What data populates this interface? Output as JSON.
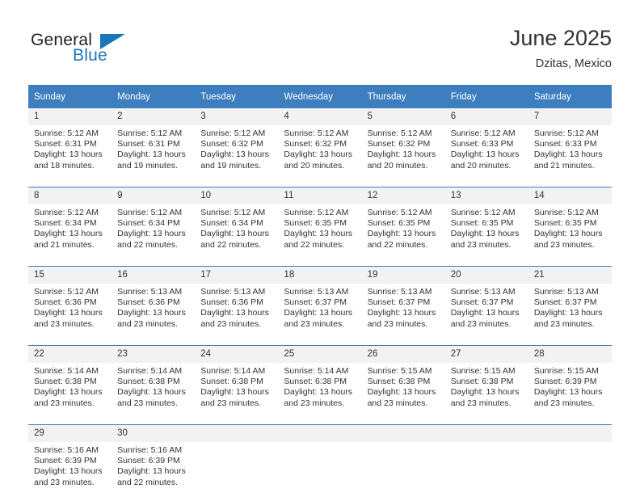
{
  "brand": {
    "name_part1": "General",
    "name_part2": "Blue",
    "triangle_icon": "triangle-icon",
    "accent_color": "#1b76bc"
  },
  "header": {
    "title": "June 2025",
    "subtitle": "Dzitas, Mexico"
  },
  "theme": {
    "header_blue": "#3d7ebf",
    "daynum_bg": "#f2f2f2",
    "text": "#333333"
  },
  "calendar": {
    "weekday_headers": [
      "Sunday",
      "Monday",
      "Tuesday",
      "Wednesday",
      "Thursday",
      "Friday",
      "Saturday"
    ],
    "weeks": [
      [
        {
          "day": "1",
          "sunrise": "Sunrise: 5:12 AM",
          "sunset": "Sunset: 6:31 PM",
          "daylight1": "Daylight: 13 hours",
          "daylight2": "and 18 minutes."
        },
        {
          "day": "2",
          "sunrise": "Sunrise: 5:12 AM",
          "sunset": "Sunset: 6:31 PM",
          "daylight1": "Daylight: 13 hours",
          "daylight2": "and 19 minutes."
        },
        {
          "day": "3",
          "sunrise": "Sunrise: 5:12 AM",
          "sunset": "Sunset: 6:32 PM",
          "daylight1": "Daylight: 13 hours",
          "daylight2": "and 19 minutes."
        },
        {
          "day": "4",
          "sunrise": "Sunrise: 5:12 AM",
          "sunset": "Sunset: 6:32 PM",
          "daylight1": "Daylight: 13 hours",
          "daylight2": "and 20 minutes."
        },
        {
          "day": "5",
          "sunrise": "Sunrise: 5:12 AM",
          "sunset": "Sunset: 6:32 PM",
          "daylight1": "Daylight: 13 hours",
          "daylight2": "and 20 minutes."
        },
        {
          "day": "6",
          "sunrise": "Sunrise: 5:12 AM",
          "sunset": "Sunset: 6:33 PM",
          "daylight1": "Daylight: 13 hours",
          "daylight2": "and 20 minutes."
        },
        {
          "day": "7",
          "sunrise": "Sunrise: 5:12 AM",
          "sunset": "Sunset: 6:33 PM",
          "daylight1": "Daylight: 13 hours",
          "daylight2": "and 21 minutes."
        }
      ],
      [
        {
          "day": "8",
          "sunrise": "Sunrise: 5:12 AM",
          "sunset": "Sunset: 6:34 PM",
          "daylight1": "Daylight: 13 hours",
          "daylight2": "and 21 minutes."
        },
        {
          "day": "9",
          "sunrise": "Sunrise: 5:12 AM",
          "sunset": "Sunset: 6:34 PM",
          "daylight1": "Daylight: 13 hours",
          "daylight2": "and 22 minutes."
        },
        {
          "day": "10",
          "sunrise": "Sunrise: 5:12 AM",
          "sunset": "Sunset: 6:34 PM",
          "daylight1": "Daylight: 13 hours",
          "daylight2": "and 22 minutes."
        },
        {
          "day": "11",
          "sunrise": "Sunrise: 5:12 AM",
          "sunset": "Sunset: 6:35 PM",
          "daylight1": "Daylight: 13 hours",
          "daylight2": "and 22 minutes."
        },
        {
          "day": "12",
          "sunrise": "Sunrise: 5:12 AM",
          "sunset": "Sunset: 6:35 PM",
          "daylight1": "Daylight: 13 hours",
          "daylight2": "and 22 minutes."
        },
        {
          "day": "13",
          "sunrise": "Sunrise: 5:12 AM",
          "sunset": "Sunset: 6:35 PM",
          "daylight1": "Daylight: 13 hours",
          "daylight2": "and 23 minutes."
        },
        {
          "day": "14",
          "sunrise": "Sunrise: 5:12 AM",
          "sunset": "Sunset: 6:35 PM",
          "daylight1": "Daylight: 13 hours",
          "daylight2": "and 23 minutes."
        }
      ],
      [
        {
          "day": "15",
          "sunrise": "Sunrise: 5:12 AM",
          "sunset": "Sunset: 6:36 PM",
          "daylight1": "Daylight: 13 hours",
          "daylight2": "and 23 minutes."
        },
        {
          "day": "16",
          "sunrise": "Sunrise: 5:13 AM",
          "sunset": "Sunset: 6:36 PM",
          "daylight1": "Daylight: 13 hours",
          "daylight2": "and 23 minutes."
        },
        {
          "day": "17",
          "sunrise": "Sunrise: 5:13 AM",
          "sunset": "Sunset: 6:36 PM",
          "daylight1": "Daylight: 13 hours",
          "daylight2": "and 23 minutes."
        },
        {
          "day": "18",
          "sunrise": "Sunrise: 5:13 AM",
          "sunset": "Sunset: 6:37 PM",
          "daylight1": "Daylight: 13 hours",
          "daylight2": "and 23 minutes."
        },
        {
          "day": "19",
          "sunrise": "Sunrise: 5:13 AM",
          "sunset": "Sunset: 6:37 PM",
          "daylight1": "Daylight: 13 hours",
          "daylight2": "and 23 minutes."
        },
        {
          "day": "20",
          "sunrise": "Sunrise: 5:13 AM",
          "sunset": "Sunset: 6:37 PM",
          "daylight1": "Daylight: 13 hours",
          "daylight2": "and 23 minutes."
        },
        {
          "day": "21",
          "sunrise": "Sunrise: 5:13 AM",
          "sunset": "Sunset: 6:37 PM",
          "daylight1": "Daylight: 13 hours",
          "daylight2": "and 23 minutes."
        }
      ],
      [
        {
          "day": "22",
          "sunrise": "Sunrise: 5:14 AM",
          "sunset": "Sunset: 6:38 PM",
          "daylight1": "Daylight: 13 hours",
          "daylight2": "and 23 minutes."
        },
        {
          "day": "23",
          "sunrise": "Sunrise: 5:14 AM",
          "sunset": "Sunset: 6:38 PM",
          "daylight1": "Daylight: 13 hours",
          "daylight2": "and 23 minutes."
        },
        {
          "day": "24",
          "sunrise": "Sunrise: 5:14 AM",
          "sunset": "Sunset: 6:38 PM",
          "daylight1": "Daylight: 13 hours",
          "daylight2": "and 23 minutes."
        },
        {
          "day": "25",
          "sunrise": "Sunrise: 5:14 AM",
          "sunset": "Sunset: 6:38 PM",
          "daylight1": "Daylight: 13 hours",
          "daylight2": "and 23 minutes."
        },
        {
          "day": "26",
          "sunrise": "Sunrise: 5:15 AM",
          "sunset": "Sunset: 6:38 PM",
          "daylight1": "Daylight: 13 hours",
          "daylight2": "and 23 minutes."
        },
        {
          "day": "27",
          "sunrise": "Sunrise: 5:15 AM",
          "sunset": "Sunset: 6:38 PM",
          "daylight1": "Daylight: 13 hours",
          "daylight2": "and 23 minutes."
        },
        {
          "day": "28",
          "sunrise": "Sunrise: 5:15 AM",
          "sunset": "Sunset: 6:39 PM",
          "daylight1": "Daylight: 13 hours",
          "daylight2": "and 23 minutes."
        }
      ],
      [
        {
          "day": "29",
          "sunrise": "Sunrise: 5:16 AM",
          "sunset": "Sunset: 6:39 PM",
          "daylight1": "Daylight: 13 hours",
          "daylight2": "and 23 minutes."
        },
        {
          "day": "30",
          "sunrise": "Sunrise: 5:16 AM",
          "sunset": "Sunset: 6:39 PM",
          "daylight1": "Daylight: 13 hours",
          "daylight2": "and 22 minutes."
        },
        {
          "day": "",
          "sunrise": "",
          "sunset": "",
          "daylight1": "",
          "daylight2": ""
        },
        {
          "day": "",
          "sunrise": "",
          "sunset": "",
          "daylight1": "",
          "daylight2": ""
        },
        {
          "day": "",
          "sunrise": "",
          "sunset": "",
          "daylight1": "",
          "daylight2": ""
        },
        {
          "day": "",
          "sunrise": "",
          "sunset": "",
          "daylight1": "",
          "daylight2": ""
        },
        {
          "day": "",
          "sunrise": "",
          "sunset": "",
          "daylight1": "",
          "daylight2": ""
        }
      ]
    ]
  }
}
